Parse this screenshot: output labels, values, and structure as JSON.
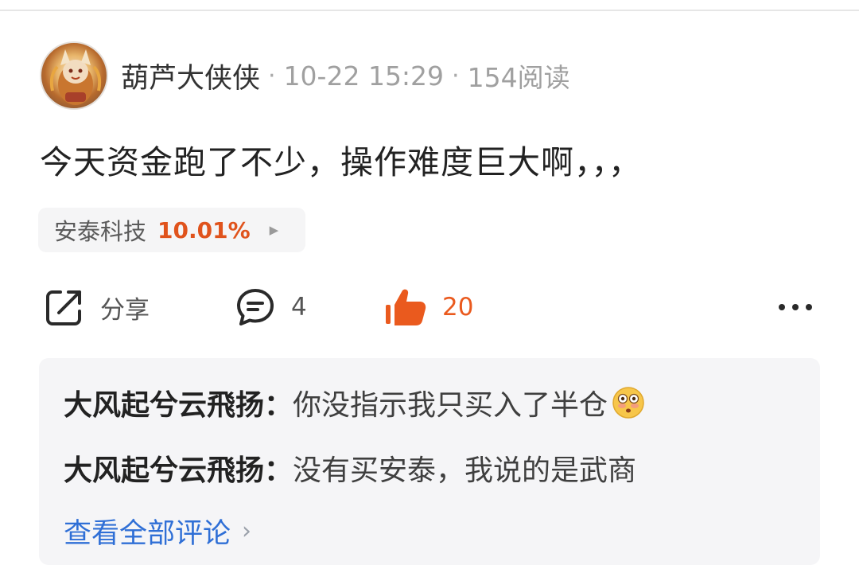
{
  "post": {
    "author": "葫芦大侠侠",
    "separator": "·",
    "timestamp": "10-22 15:29",
    "reads": "154阅读",
    "content": "今天资金跑了不少，操作难度巨大啊，，，"
  },
  "stock": {
    "name": "安泰科技",
    "change": "10.01%",
    "change_color": "#e0531c"
  },
  "actions": {
    "share_label": "分享",
    "comment_count": "4",
    "like_count": "20",
    "like_color": "#ea5a1e"
  },
  "comments": [
    {
      "author": "大风起兮云飛扬：",
      "text": "你没指示我只买入了半仓",
      "emoji": "flushed-emoji"
    },
    {
      "author": "大风起兮云飛扬：",
      "text": "没有买安泰，我说的是武商"
    }
  ],
  "view_all": {
    "label": "查看全部评论",
    "icon": "chevron-right-icon"
  },
  "icons": {
    "share": "share-icon",
    "comment": "comment-icon",
    "like": "thumbs-up-icon",
    "more": "more-horizontal-icon",
    "play": "play-arrow-icon"
  }
}
